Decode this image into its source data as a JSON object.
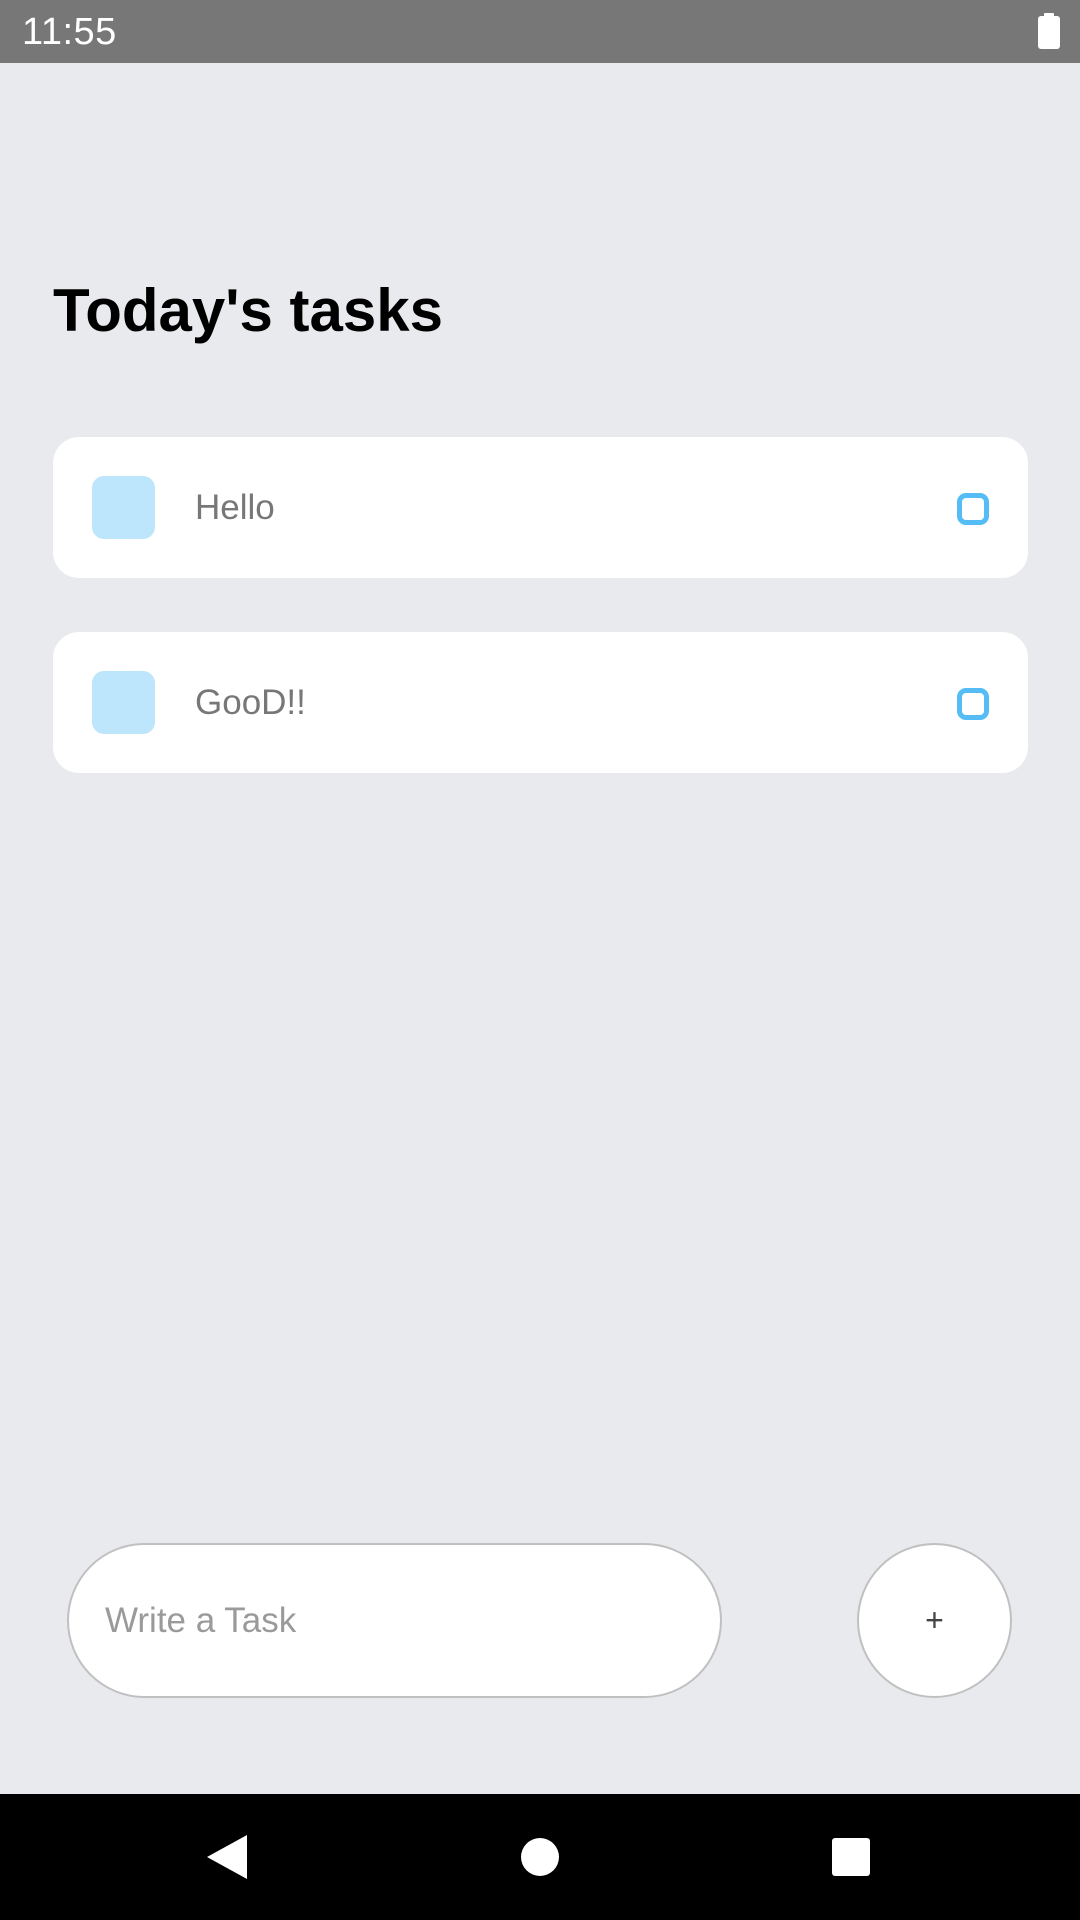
{
  "status_bar": {
    "time": "11:55",
    "battery_icon": "battery-full-icon"
  },
  "main": {
    "title": "Today's tasks",
    "tasks": [
      {
        "text": "Hello"
      },
      {
        "text": "GooD!!"
      }
    ]
  },
  "composer": {
    "input_placeholder": "Write a Task",
    "input_value": "",
    "add_button_label": "+"
  },
  "nav_bar": {
    "back_icon": "back-triangle-icon",
    "home_icon": "home-circle-icon",
    "recents_icon": "recents-square-icon"
  },
  "colors": {
    "background": "#E8EAED",
    "card": "#FFFFFF",
    "task_square": "#BDE5FB",
    "task_circle": "#55BCF6",
    "status_bar": "#777777",
    "nav_bar": "#000000"
  }
}
